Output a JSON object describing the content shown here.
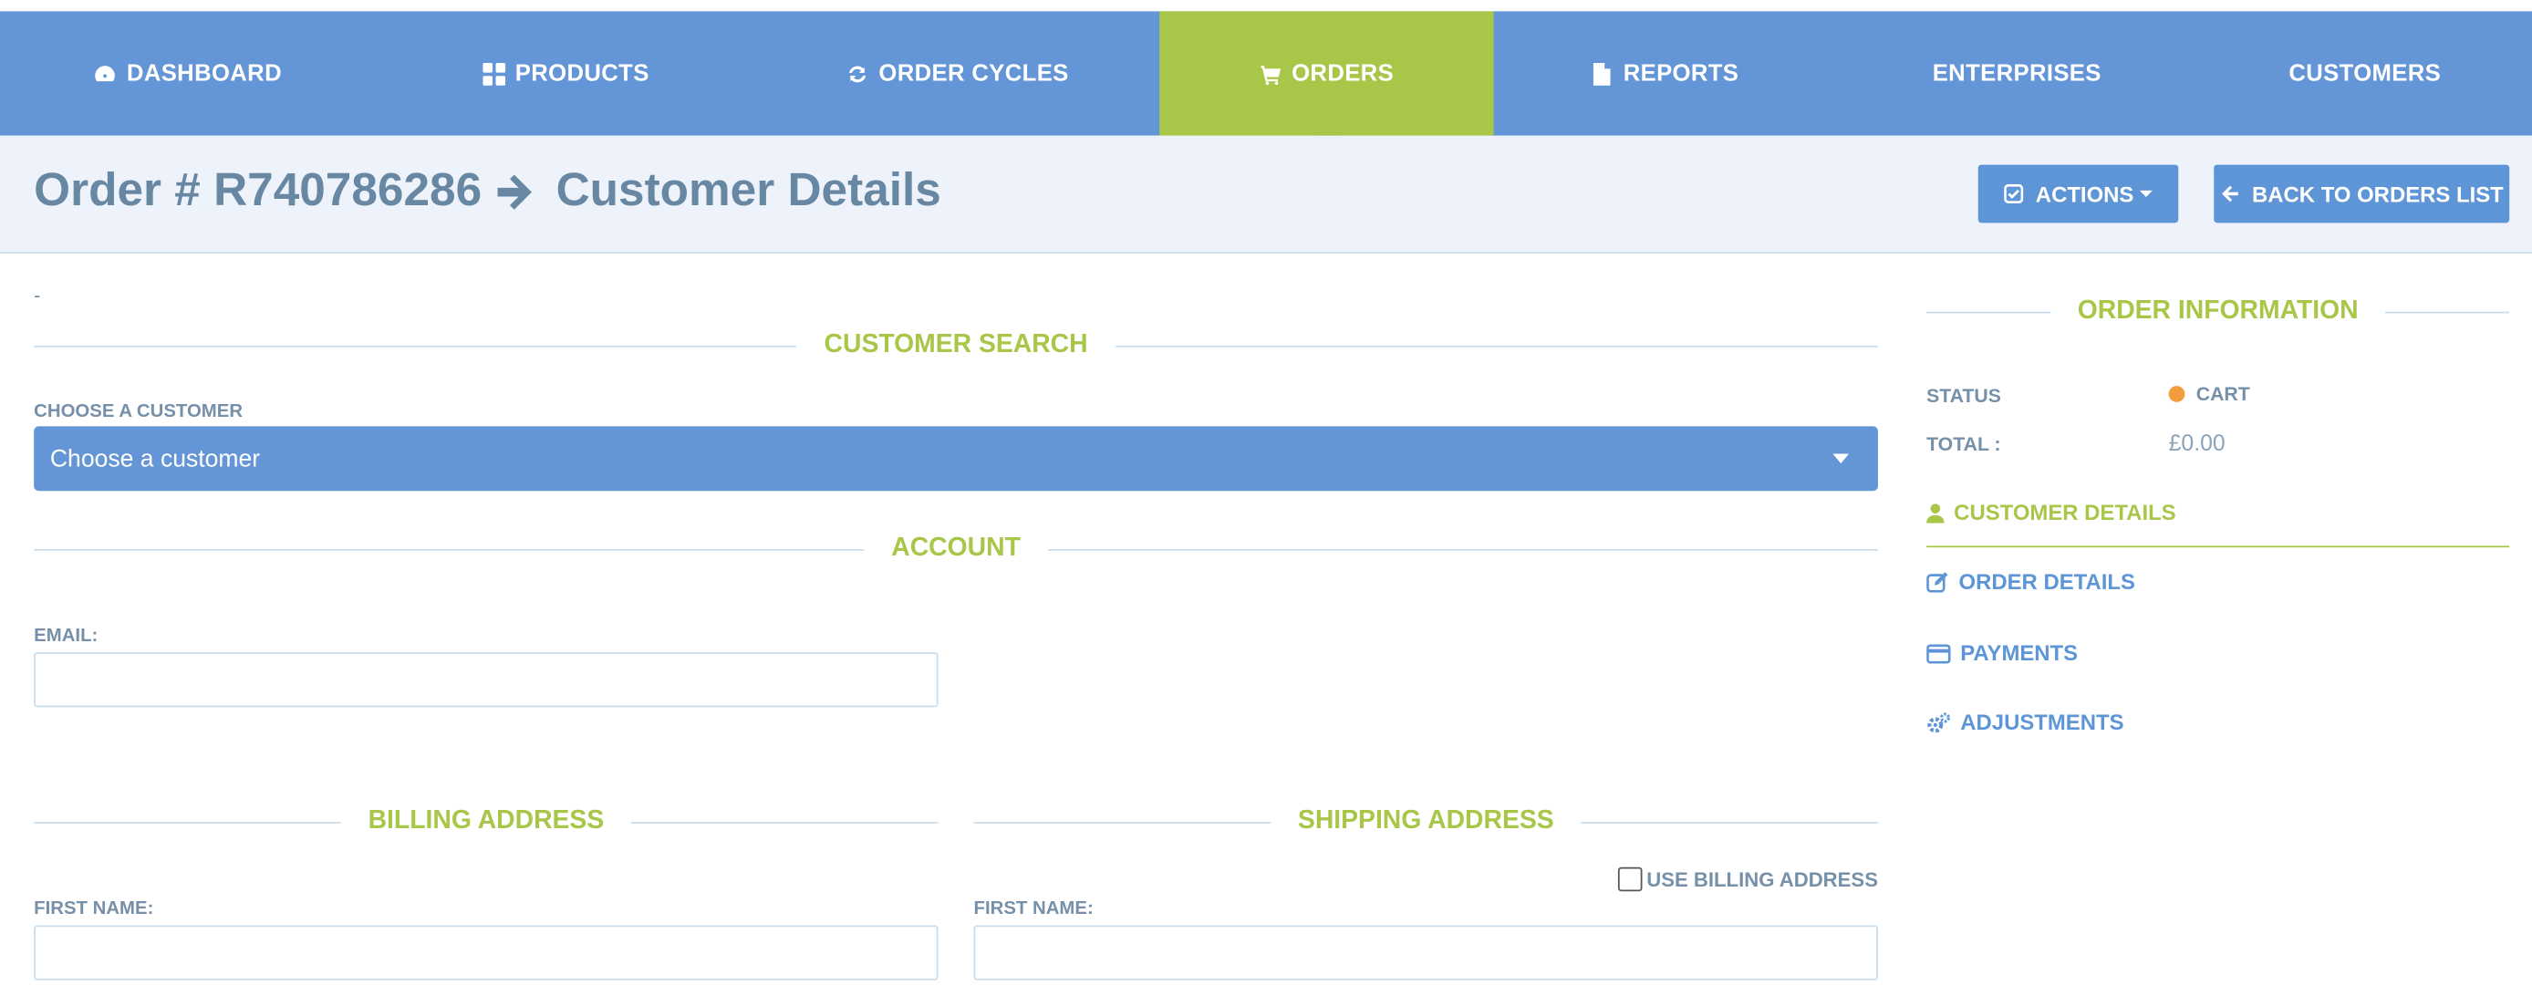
{
  "nav": {
    "items": [
      {
        "label": "Dashboard",
        "icon": "tachometer-icon"
      },
      {
        "label": "Products",
        "icon": "grid-icon"
      },
      {
        "label": "Order Cycles",
        "icon": "refresh-icon"
      },
      {
        "label": "Orders",
        "icon": "cart-icon",
        "active": true
      },
      {
        "label": "Reports",
        "icon": "file-icon"
      },
      {
        "label": "Enterprises",
        "icon": ""
      },
      {
        "label": "Customers",
        "icon": ""
      }
    ]
  },
  "header": {
    "order_title": "Order # R740786286",
    "page_title": "Customer Details",
    "actions_label": "Actions",
    "back_label": "Back to orders list"
  },
  "main": {
    "dash": "-",
    "customer_search": {
      "section_title": "Customer Search",
      "label": "Choose a customer",
      "select_value": "Choose a customer"
    },
    "account": {
      "section_title": "Account",
      "email_label": "Email:",
      "email_value": ""
    },
    "billing": {
      "section_title": "Billing Address",
      "first_name_label": "First name:",
      "first_name_value": ""
    },
    "shipping": {
      "section_title": "Shipping Address",
      "use_billing_label": "Use billing address",
      "use_billing_checked": false,
      "first_name_label": "First name:",
      "first_name_value": ""
    }
  },
  "sidebar": {
    "section_title": "Order Information",
    "status_label": "Status",
    "status_value": "Cart",
    "total_label": "Total :",
    "total_value": "£0.00",
    "links": [
      {
        "label": "Customer Details",
        "icon": "user-icon",
        "active": true
      },
      {
        "label": "Order Details",
        "icon": "edit-icon"
      },
      {
        "label": "Payments",
        "icon": "credit-card-icon"
      },
      {
        "label": "Adjustments",
        "icon": "cogs-icon"
      }
    ]
  },
  "colors": {
    "nav_bg": "#6495d6",
    "accent_green": "#a8c648",
    "primary_blue": "#5d95d7",
    "status_orange": "#f39c3c"
  }
}
